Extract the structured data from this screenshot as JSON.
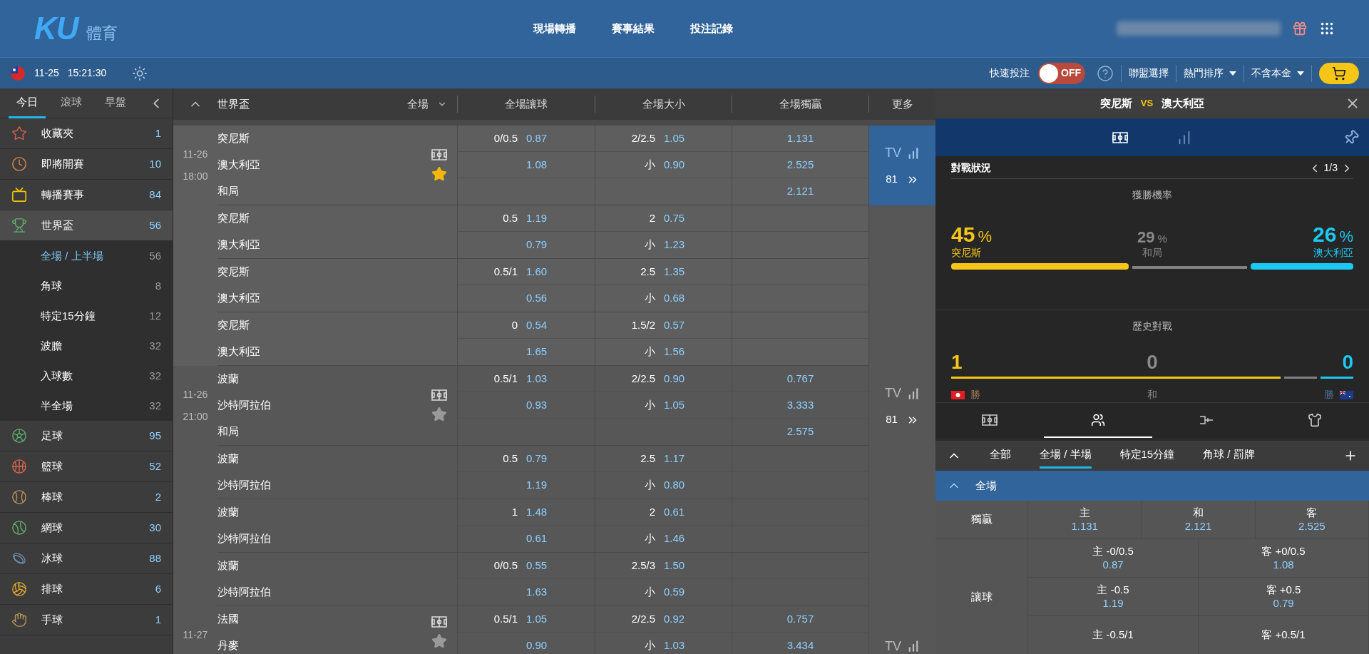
{
  "logo": {
    "text": "KU",
    "subtitle": "體育"
  },
  "nav": [
    {
      "label": "現場轉播"
    },
    {
      "label": "賽事結果"
    },
    {
      "label": "投注記錄"
    }
  ],
  "subbar": {
    "date": "11-25",
    "time": "15:21:30",
    "quick_bet": {
      "label": "快速投注",
      "on": false,
      "state_label": "OFF"
    },
    "menus": [
      {
        "label": "聯盟選擇",
        "dropdown": false
      },
      {
        "label": "熱門排序",
        "dropdown": true
      },
      {
        "label": "不含本金",
        "dropdown": true
      }
    ]
  },
  "sidebar": {
    "tabs": [
      {
        "label": "今日",
        "selected": true
      },
      {
        "label": "滾球",
        "selected": false
      },
      {
        "label": "早盤",
        "selected": false
      }
    ],
    "items": [
      {
        "label": "收藏夾",
        "count": "1",
        "kind": "star",
        "selected": false
      },
      {
        "label": "即將開賽",
        "count": "10",
        "kind": "soon",
        "selected": false
      },
      {
        "label": "轉播賽事",
        "count": "84",
        "kind": "tv",
        "selected": false
      },
      {
        "label": "世界盃",
        "count": "56",
        "kind": "trophy",
        "selected": true,
        "expanded": true,
        "children": [
          {
            "label": "全場 / 上半場",
            "count": "56",
            "selected": true
          },
          {
            "label": "角球",
            "count": "8",
            "selected": false
          },
          {
            "label": "特定15分鐘",
            "count": "12",
            "selected": false
          },
          {
            "label": "波膽",
            "count": "32",
            "selected": false
          },
          {
            "label": "入球數",
            "count": "32",
            "selected": false
          },
          {
            "label": "半全場",
            "count": "32",
            "selected": false
          }
        ]
      },
      {
        "label": "足球",
        "count": "95",
        "kind": "soccer",
        "selected": false
      },
      {
        "label": "籃球",
        "count": "52",
        "kind": "basketball",
        "selected": false
      },
      {
        "label": "棒球",
        "count": "2",
        "kind": "baseball",
        "selected": false
      },
      {
        "label": "網球",
        "count": "30",
        "kind": "tennis",
        "selected": false
      },
      {
        "label": "冰球",
        "count": "88",
        "kind": "hockey",
        "selected": false
      },
      {
        "label": "排球",
        "count": "6",
        "kind": "volleyball",
        "selected": false
      },
      {
        "label": "手球",
        "count": "1",
        "kind": "handball",
        "selected": false
      }
    ]
  },
  "table": {
    "league": "世界盃",
    "period": "全場",
    "columns": [
      "全場讓球",
      "全場大小",
      "全場獨贏",
      "更多"
    ],
    "matches": [
      {
        "date": "11-26",
        "time": "18:00",
        "favorite": true,
        "selected": true,
        "tv_label": "TV",
        "tv_count": "81",
        "rows": [
          {
            "teams": [
              "突尼斯",
              "澳大利亞",
              "和局"
            ],
            "hdp_line": "0/0.5",
            "hdp": [
              "0.87",
              "1.08"
            ],
            "ou_line": "2/2.5",
            "under_label": "小",
            "ou": [
              "1.05",
              "0.90"
            ],
            "x12": [
              "1.131",
              "2.525",
              "2.121"
            ]
          },
          {
            "teams": [
              "突尼斯",
              "澳大利亞"
            ],
            "hdp_line": "0.5",
            "hdp": [
              "1.19",
              "0.79"
            ],
            "ou_line": "2",
            "under_label": "小",
            "ou": [
              "0.75",
              "1.23"
            ]
          },
          {
            "teams": [
              "突尼斯",
              "澳大利亞"
            ],
            "hdp_line": "0.5/1",
            "hdp": [
              "1.60",
              "0.56"
            ],
            "ou_line": "2.5",
            "under_label": "小",
            "ou": [
              "1.35",
              "0.68"
            ]
          },
          {
            "teams": [
              "突尼斯",
              "澳大利亞"
            ],
            "hdp_line": "0",
            "hdp": [
              "0.54",
              "1.65"
            ],
            "ou_line": "1.5/2",
            "under_label": "小",
            "ou": [
              "0.57",
              "1.56"
            ]
          }
        ]
      },
      {
        "date": "11-26",
        "time": "21:00",
        "favorite": false,
        "selected": false,
        "tv_label": "TV",
        "tv_count": "81",
        "rows": [
          {
            "teams": [
              "波蘭",
              "沙特阿拉伯",
              "和局"
            ],
            "hdp_line": "0.5/1",
            "hdp": [
              "1.03",
              "0.93"
            ],
            "ou_line": "2/2.5",
            "under_label": "小",
            "ou": [
              "0.90",
              "1.05"
            ],
            "x12": [
              "0.767",
              "3.333",
              "2.575"
            ]
          },
          {
            "teams": [
              "波蘭",
              "沙特阿拉伯"
            ],
            "hdp_line": "0.5",
            "hdp": [
              "0.79",
              "1.19"
            ],
            "ou_line": "2.5",
            "under_label": "小",
            "ou": [
              "1.17",
              "0.80"
            ]
          },
          {
            "teams": [
              "波蘭",
              "沙特阿拉伯"
            ],
            "hdp_line": "1",
            "hdp": [
              "1.48",
              "0.61"
            ],
            "ou_line": "2",
            "under_label": "小",
            "ou": [
              "0.61",
              "1.46"
            ]
          },
          {
            "teams": [
              "波蘭",
              "沙特阿拉伯"
            ],
            "hdp_line": "0/0.5",
            "hdp": [
              "0.55",
              "1.63"
            ],
            "ou_line": "2.5/3",
            "under_label": "小",
            "ou": [
              "1.50",
              "0.59"
            ]
          }
        ]
      },
      {
        "date": "11-27",
        "favorite": false,
        "selected": false,
        "tv_label": "TV",
        "rows": [
          {
            "teams": [
              "法國",
              "丹麥"
            ],
            "hdp_line": "0.5/1",
            "hdp": [
              "1.05",
              "0.90"
            ],
            "ou_line": "2/2.5",
            "under_label": "小",
            "ou": [
              "0.92",
              "1.03"
            ],
            "x12": [
              "0.757",
              "3.434"
            ]
          }
        ]
      }
    ]
  },
  "detail": {
    "home": "突尼斯",
    "vs": "VS",
    "away": "澳大利亞",
    "view_tabs": [
      {
        "kind": "pitch",
        "selected": true
      },
      {
        "kind": "stats",
        "selected": false
      }
    ],
    "section_title": "對戰狀況",
    "pager": "1/3",
    "win_prob": {
      "title": "獲勝機率",
      "unit": "%",
      "home": {
        "value": "45",
        "label": "突尼斯"
      },
      "draw": {
        "value": "29",
        "label": "和局"
      },
      "away": {
        "value": "26",
        "label": "澳大利亞"
      }
    },
    "history": {
      "title": "歷史對戰",
      "home": "1",
      "draw": "0",
      "away": "0",
      "home_label": "勝",
      "draw_label": "和",
      "away_label": "勝"
    },
    "icon_tabs": [
      {
        "kind": "pitch",
        "selected": false
      },
      {
        "kind": "lineup",
        "selected": true
      },
      {
        "kind": "bracket",
        "selected": false
      },
      {
        "kind": "jersey",
        "selected": false
      }
    ],
    "market_tabs": [
      {
        "label": "全部",
        "selected": false
      },
      {
        "label": "全場 / 半場",
        "selected": true
      },
      {
        "label": "特定15分鐘",
        "selected": false
      },
      {
        "label": "角球 / 罰牌",
        "selected": false
      }
    ],
    "section": {
      "label": "全場",
      "expanded": true
    },
    "moneyline": {
      "label": "獨贏",
      "cells": [
        {
          "label": "主",
          "odds": "1.131"
        },
        {
          "label": "和",
          "odds": "2.121"
        },
        {
          "label": "客",
          "odds": "2.525"
        }
      ]
    },
    "handicap": {
      "label": "讓球",
      "rows": [
        [
          {
            "label": "主 -0/0.5",
            "odds": "0.87"
          },
          {
            "label": "客 +0/0.5",
            "odds": "1.08"
          }
        ],
        [
          {
            "label": "主 -0.5",
            "odds": "1.19"
          },
          {
            "label": "客 +0.5",
            "odds": "0.79"
          }
        ],
        [
          {
            "label": "主 -0.5/1"
          },
          {
            "label": "客 +0.5/1"
          }
        ]
      ]
    }
  }
}
